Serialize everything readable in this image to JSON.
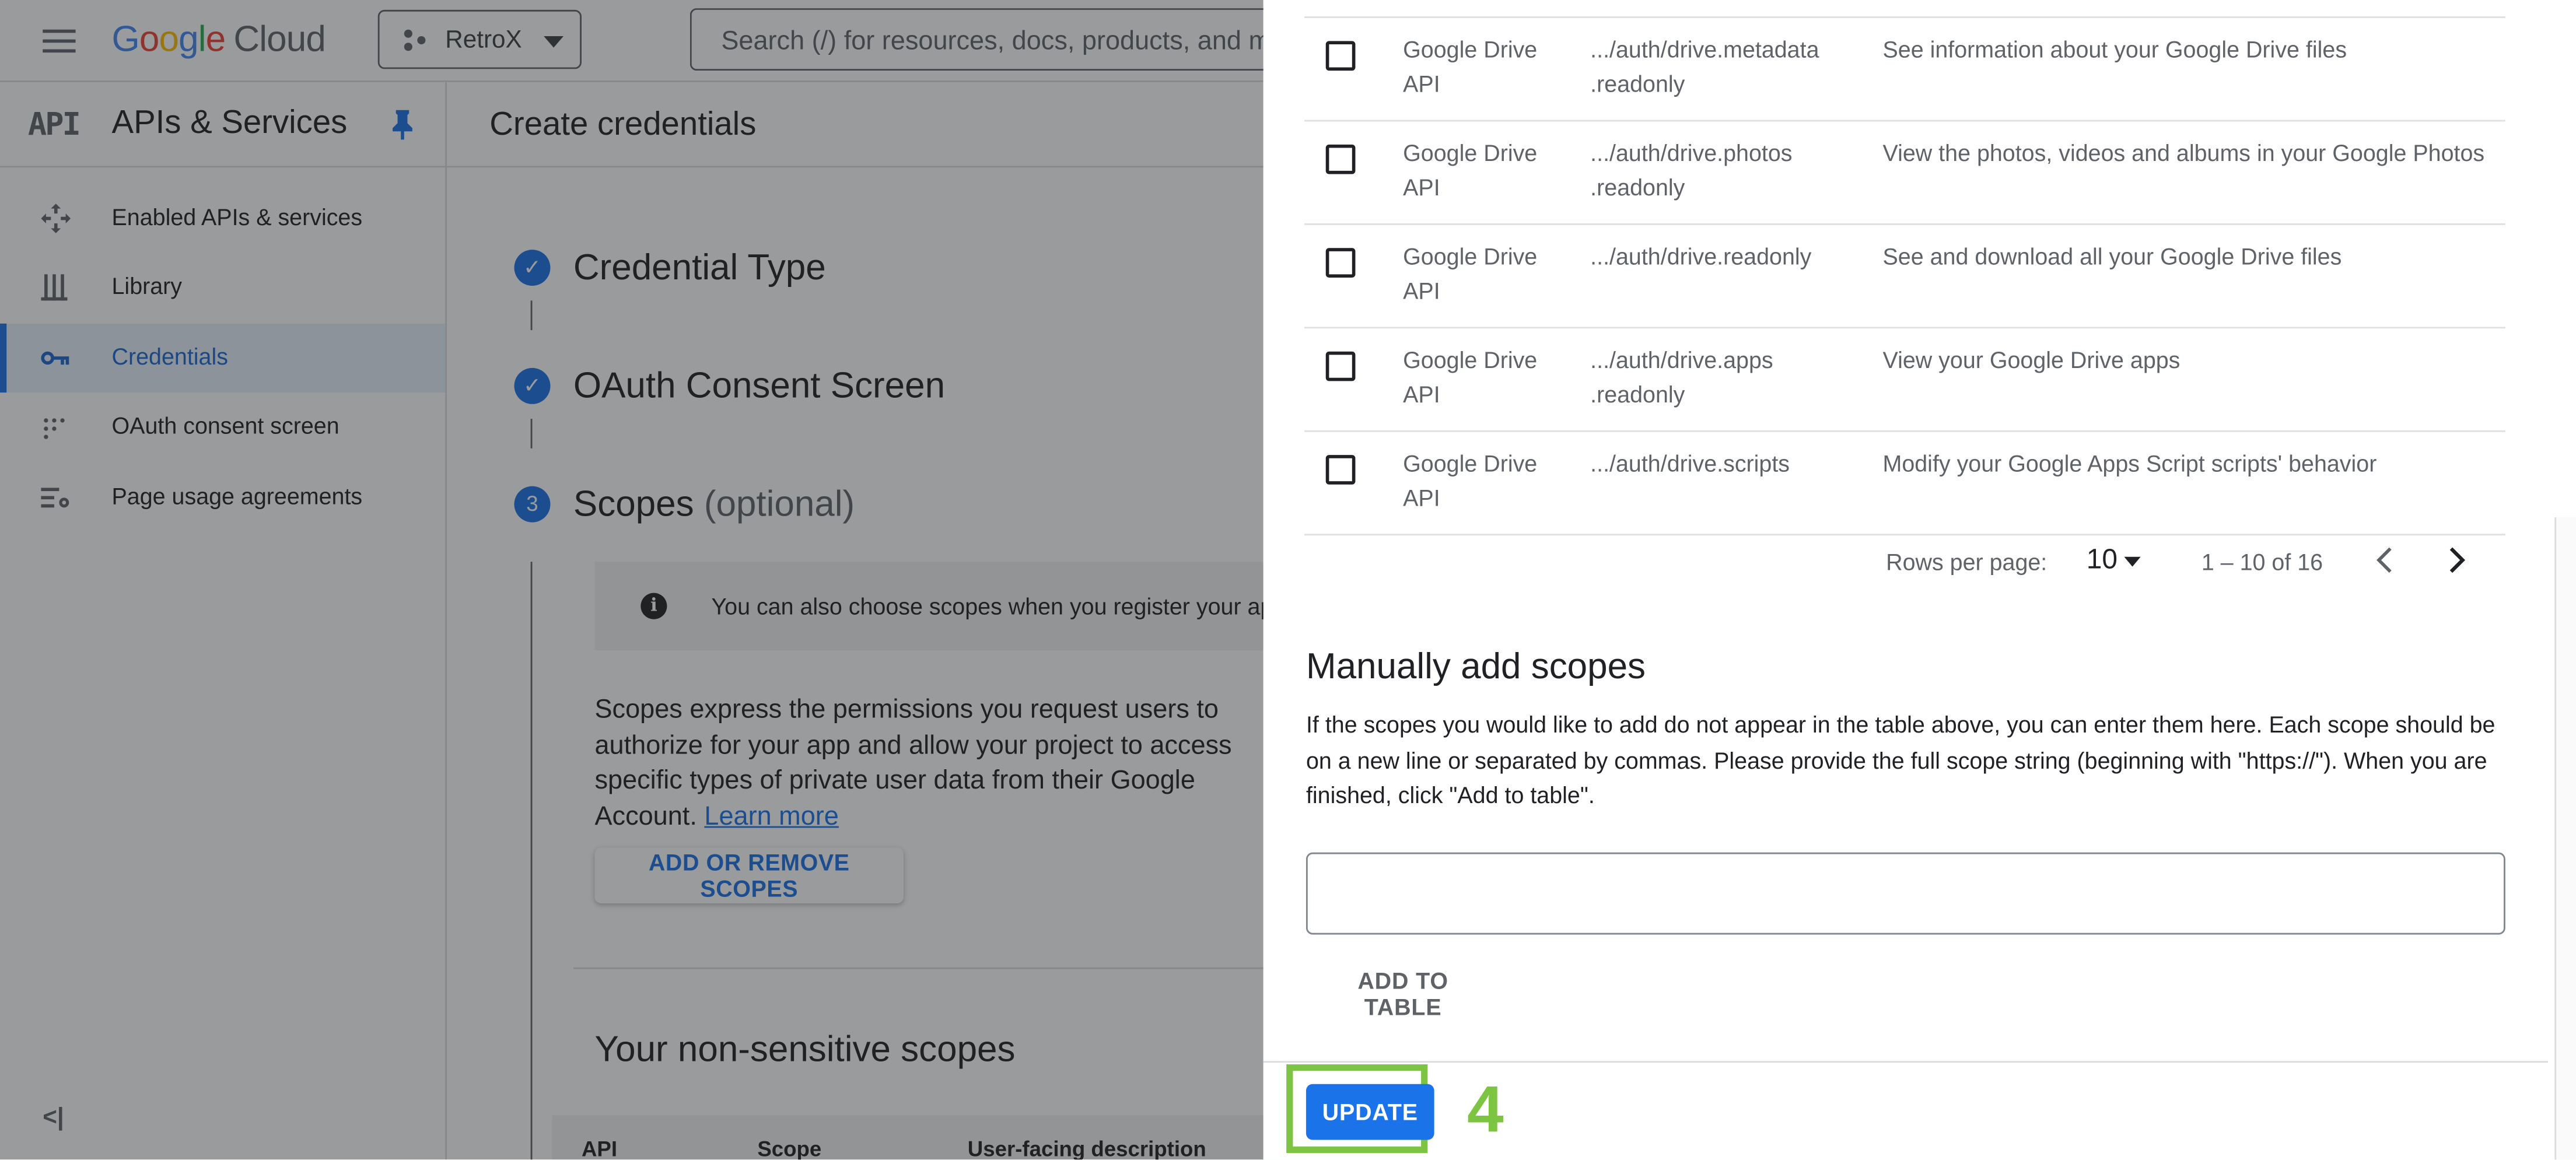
{
  "topbar": {
    "logo_g": "G",
    "logo_o1": "o",
    "logo_o2": "o",
    "logo_g2": "g",
    "logo_l": "l",
    "logo_e": "e",
    "logo_cloud": "Cloud",
    "project_name": "RetroX",
    "search_placeholder": "Search (/) for resources, docs, products, and more"
  },
  "sidebar": {
    "api_glyph": "API",
    "title": "APIs & Services",
    "items": [
      {
        "label": "Enabled APIs & services"
      },
      {
        "label": "Library"
      },
      {
        "label": "Credentials"
      },
      {
        "label": "OAuth consent screen"
      },
      {
        "label": "Page usage agreements"
      }
    ],
    "collapse_glyph": "<|"
  },
  "main": {
    "page_title": "Create credentials",
    "steps": [
      {
        "title": "Credential Type",
        "marker": "✓"
      },
      {
        "title": "OAuth Consent Screen",
        "marker": "✓"
      },
      {
        "title": "Scopes",
        "optional": "(optional)",
        "marker": "3"
      }
    ],
    "info_text": "You can also choose scopes when you register your app.",
    "description": "Scopes express the permissions you request users to authorize for your app and allow your project to access specific types of private user data from their Google Account.",
    "learn_more": "Learn more",
    "add_remove_button": "ADD OR REMOVE SCOPES",
    "nonsensitive_title": "Your non-sensitive scopes",
    "table_headers": {
      "api": "API",
      "scope": "Scope",
      "description": "User-facing description"
    }
  },
  "panel": {
    "rows": [
      {
        "api": "Google Drive API",
        "scope": ".../auth/drive.metadata .readonly",
        "description": "See information about your Google Drive files"
      },
      {
        "api": "Google Drive API",
        "scope": ".../auth/drive.photos .readonly",
        "description": "View the photos, videos and albums in your Google Photos"
      },
      {
        "api": "Google Drive API",
        "scope": ".../auth/drive.readonly",
        "description": "See and download all your Google Drive files"
      },
      {
        "api": "Google Drive API",
        "scope": ".../auth/drive.apps .readonly",
        "description": "View your Google Drive apps"
      },
      {
        "api": "Google Drive API",
        "scope": ".../auth/drive.scripts",
        "description": "Modify your Google Apps Script scripts' behavior"
      }
    ],
    "pager": {
      "rows_per_page_label": "Rows per page:",
      "rows_per_page": "10",
      "range": "1 – 10 of 16"
    },
    "manual_title": "Manually add scopes",
    "manual_text": "If the scopes you would like to add do not appear in the table above, you can enter them here. Each scope should be on a new line or separated by commas. Please provide the full scope string (beginning with \"https://\"). When you are finished, click \"Add to table\".",
    "manual_input_value": "",
    "add_to_table_button": "ADD TO TABLE",
    "update_button": "UPDATE",
    "annotation_number": "4"
  },
  "colors": {
    "accent": "#1a73e8",
    "annotation": "#7cc442",
    "overlay": "rgba(32,33,36,0.45)"
  }
}
